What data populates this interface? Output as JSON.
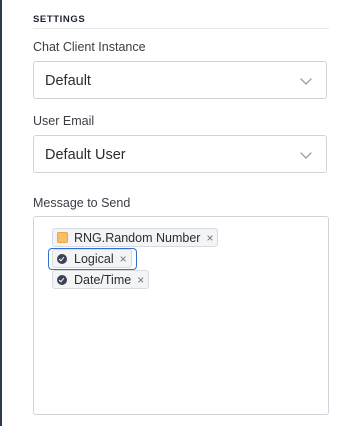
{
  "settings": {
    "title": "SETTINGS"
  },
  "chat_client": {
    "label": "Chat Client Instance",
    "value": "Default"
  },
  "user_email": {
    "label": "User Email",
    "value": "Default User"
  },
  "message": {
    "label": "Message to Send",
    "tokens": [
      {
        "label": "RNG.Random Number",
        "remove": "×",
        "icon": "rng-square-icon",
        "icon_color": "#f2a33a"
      },
      {
        "label": "Logical",
        "remove": "×",
        "icon": "check-circle-icon",
        "icon_color": "#3a4256"
      },
      {
        "label": "Date/Time",
        "remove": "×",
        "icon": "check-circle-icon",
        "icon_color": "#3a4256"
      }
    ]
  },
  "colors": {
    "accent_focus": "#2f6fd1",
    "border": "#cfd3da",
    "token_bg": "#f3f4f6"
  }
}
